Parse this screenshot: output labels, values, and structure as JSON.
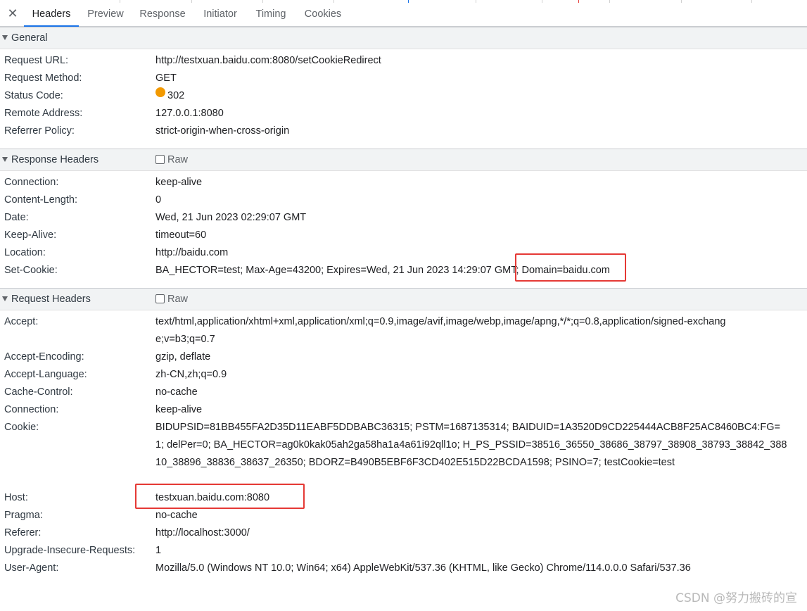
{
  "tabs": [
    "Headers",
    "Preview",
    "Response",
    "Initiator",
    "Timing",
    "Cookies"
  ],
  "active_tab": "Headers",
  "colors": {
    "accent": "#1a73e8",
    "status_warning": "#f29900",
    "highlight": "#e53935"
  },
  "general": {
    "title": "General",
    "rows": [
      {
        "key": "Request URL:",
        "value": "http://testxuan.baidu.com:8080/setCookieRedirect"
      },
      {
        "key": "Request Method:",
        "value": "GET"
      },
      {
        "key": "Status Code:",
        "value": "302"
      },
      {
        "key": "Remote Address:",
        "value": "127.0.0.1:8080"
      },
      {
        "key": "Referrer Policy:",
        "value": "strict-origin-when-cross-origin"
      }
    ]
  },
  "response_headers": {
    "title": "Response Headers",
    "raw_label": "Raw",
    "rows": [
      {
        "key": "Connection:",
        "value": "keep-alive"
      },
      {
        "key": "Content-Length:",
        "value": "0"
      },
      {
        "key": "Date:",
        "value": "Wed, 21 Jun 2023 02:29:07 GMT"
      },
      {
        "key": "Keep-Alive:",
        "value": "timeout=60"
      },
      {
        "key": "Location:",
        "value": "http://baidu.com"
      },
      {
        "key": "Set-Cookie:",
        "value": "BA_HECTOR=test; Max-Age=43200; Expires=Wed, 21 Jun 2023 14:29:07 GMT; Domain=baidu.com"
      }
    ]
  },
  "request_headers": {
    "title": "Request Headers",
    "raw_label": "Raw",
    "rows": [
      {
        "key": "Accept:",
        "value": "text/html,application/xhtml+xml,application/xml;q=0.9,image/avif,image/webp,image/apng,*/*;q=0.8,application/signed-exchange;v=b3;q=0.7"
      },
      {
        "key": "Accept-Encoding:",
        "value": "gzip, deflate"
      },
      {
        "key": "Accept-Language:",
        "value": "zh-CN,zh;q=0.9"
      },
      {
        "key": "Cache-Control:",
        "value": "no-cache"
      },
      {
        "key": "Connection:",
        "value": "keep-alive"
      },
      {
        "key": "Cookie:",
        "value": "BIDUPSID=81BB455FA2D35D11EABF5DDBABC36315; PSTM=1687135314; BAIDUID=1A3520D9CD225444ACB8F25AC8460BC4:FG=1; delPer=0; BA_HECTOR=ag0k0kak05ah2ga58ha1a4a61i92qll1o; H_PS_PSSID=38516_36550_38686_38797_38908_38793_38842_38810_38896_38836_38637_26350; BDORZ=B490B5EBF6F3CD402E515D22BCDA1598; PSINO=7; testCookie=test"
      },
      {
        "key": "Host:",
        "value": "testxuan.baidu.com:8080"
      },
      {
        "key": "Pragma:",
        "value": "no-cache"
      },
      {
        "key": "Referer:",
        "value": "http://localhost:3000/"
      },
      {
        "key": "Upgrade-Insecure-Requests:",
        "value": "1"
      },
      {
        "key": "User-Agent:",
        "value": "Mozilla/5.0 (Windows NT 10.0; Win64; x64) AppleWebKit/537.36 (KHTML, like Gecko) Chrome/114.0.0.0 Safari/537.36"
      }
    ]
  },
  "watermark": "CSDN @努力搬砖的宣"
}
